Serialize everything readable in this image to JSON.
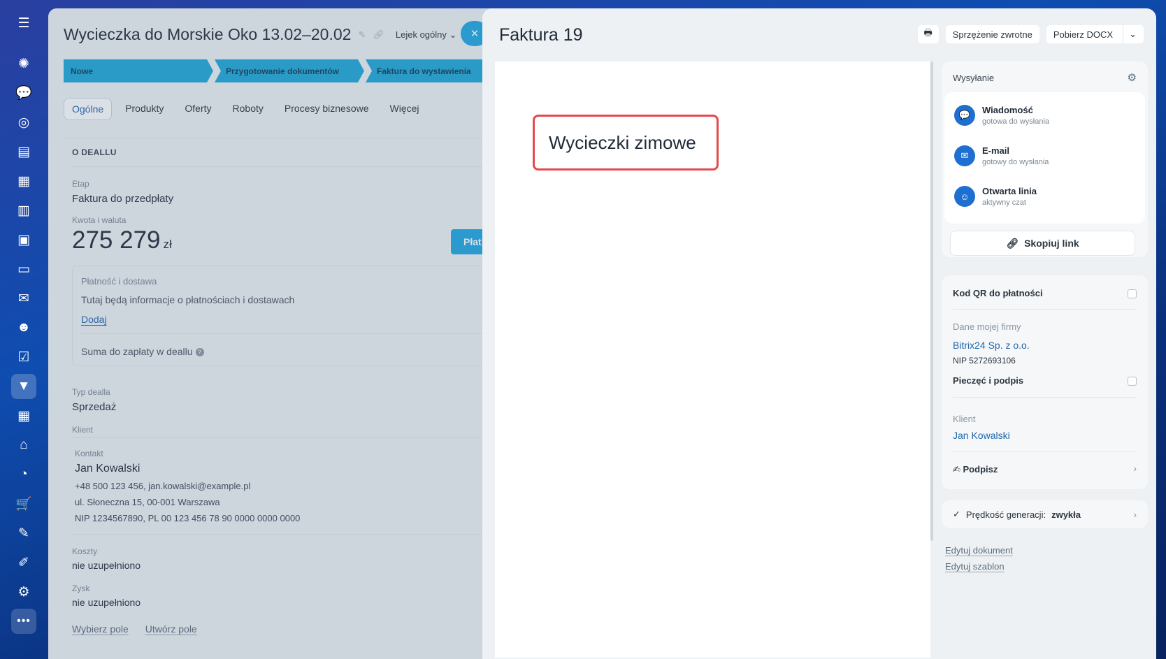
{
  "deal": {
    "title": "Wycieczka do Morskie Oko 13.02–20.02",
    "funnel": "Lejek ogólny",
    "stages": [
      "Nowe",
      "Przygotowanie dokumentów",
      "Faktura do wystawienia"
    ],
    "tabs": [
      "Ogólne",
      "Produkty",
      "Oferty",
      "Roboty",
      "Procesy biznesowe",
      "Więcej"
    ],
    "section_title": "O DEALLU",
    "stage_label": "Etap",
    "stage_value": "Faktura do przedpłaty",
    "amount_label": "Kwota i waluta",
    "amount": "275 279",
    "currency": "zł",
    "pay_button": "Płat",
    "payment_title": "Płatność i dostawa",
    "payment_info": "Tutaj będą informacje o płatnościach i dostawach",
    "add_link": "Dodaj",
    "sum_label": "Suma do zapłaty w deallu",
    "type_label": "Typ dealla",
    "type_value": "Sprzedaż",
    "client_label": "Klient",
    "contact_label": "Kontakt",
    "contact_name": "Jan Kowalski",
    "contact_phone_email": "+48 500 123 456, jan.kowalski@example.pl",
    "contact_address": "ul. Słoneczna 15, 00-001 Warszawa",
    "contact_nip": "NIP 1234567890, PL 00 123 456 78 90 0000 0000 0000",
    "costs_label": "Koszty",
    "costs_value": "nie uzupełniono",
    "profit_label": "Zysk",
    "profit_value": "nie uzupełniono",
    "select_field": "Wybierz pole",
    "create_field": "Utwórz pole"
  },
  "invoice": {
    "title": "Faktura 19",
    "feedback": "Sprzężenie zwrotne",
    "download": "Pobierz DOCX",
    "doc_heading": "Wycieczki zimowe",
    "send_title": "Wysyłanie",
    "channels": [
      {
        "title": "Wiadomość",
        "sub": "gotowa do wysłania"
      },
      {
        "title": "E-mail",
        "sub": "gotowy do wysłania"
      },
      {
        "title": "Otwarta linia",
        "sub": "aktywny czat"
      }
    ],
    "copy_link": "Skopiuj link",
    "qr": "Kod QR do płatności",
    "company_label": "Dane mojej firmy",
    "company_name": "Bitrix24 Sp. z o.o.",
    "company_nip": "NIP 5272693106",
    "stamp": "Pieczęć i podpis",
    "client_label": "Klient",
    "client_name": "Jan Kowalski",
    "sign": "Podpisz",
    "speed_label": "Prędkość generacji:",
    "speed_value": "zwykła",
    "edit_document": "Edytuj dokument",
    "edit_template": "Edytuj szablon"
  },
  "icons": {
    "menu": "hamburger-icon",
    "rail": [
      "sparkle-icon",
      "chat-icon",
      "target-icon",
      "document-icon",
      "calendar-icon",
      "file-icon",
      "presentation-icon",
      "card-icon",
      "mail-icon",
      "contacts-icon",
      "checkbox-icon",
      "crm-funnel-icon",
      "planner-icon",
      "store-icon",
      "analytics-icon",
      "cart-icon",
      "sign-doc-icon",
      "pen-icon",
      "gear-icon",
      "more-icon"
    ]
  },
  "colors": {
    "accent": "#1ea7e1",
    "stage": "#1ca8d6",
    "highlight": "#e5484d",
    "link": "#2067b0"
  }
}
